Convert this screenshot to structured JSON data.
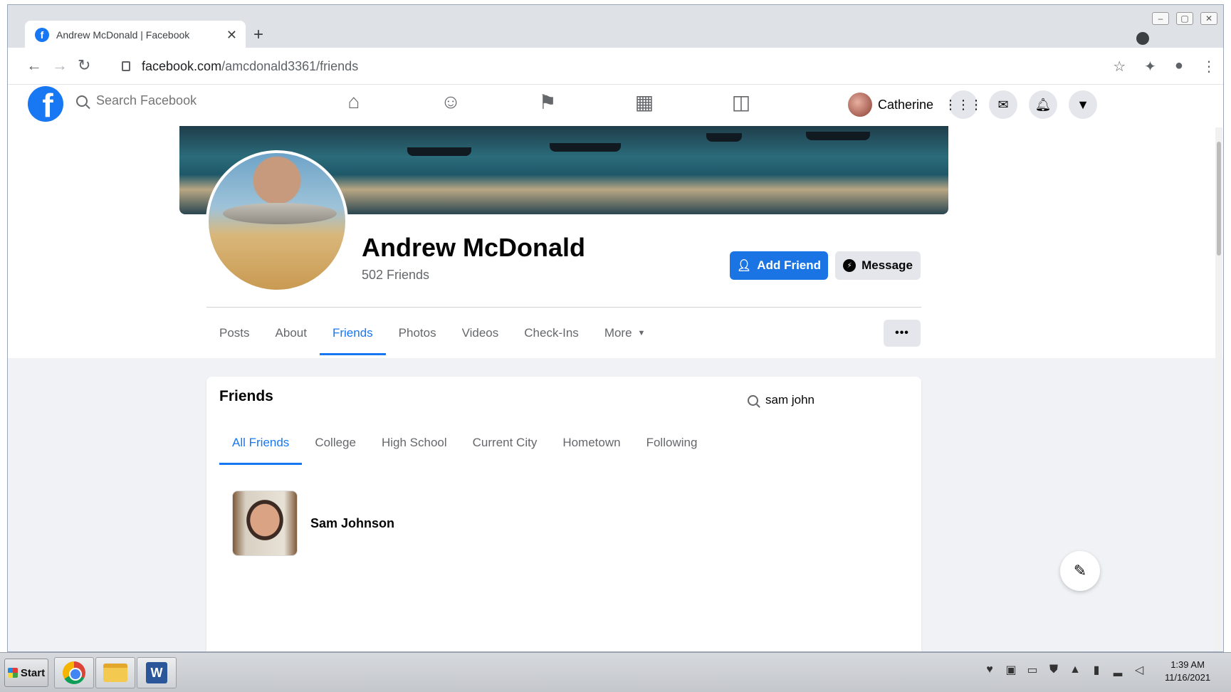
{
  "browser": {
    "tab_title": "Andrew McDonald | Facebook",
    "tab_close": "✕",
    "new_tab": "+",
    "url_host": "facebook.com",
    "url_path": "/amcdonald3361/friends",
    "icons": [
      "back-icon",
      "forward-icon",
      "reload-icon",
      "lock-icon",
      "star-icon",
      "extensions-icon",
      "profile-icon",
      "menu-icon"
    ]
  },
  "fb_header": {
    "logo": "f",
    "search_placeholder": "Search Facebook",
    "nav_icons": [
      "home-icon",
      "friends-icon",
      "pages-icon",
      "marketplace-icon",
      "gaming-icon"
    ],
    "user_name": "Catherine",
    "action_icons": [
      "menu-grid-icon",
      "messenger-icon",
      "notifications-icon",
      "account-dropdown-icon"
    ]
  },
  "profile": {
    "name": "Andrew McDonald",
    "friend_count": "502 Friends",
    "add_friend_label": "Add Friend",
    "message_label": "Message",
    "tabs": [
      {
        "label": "Posts",
        "active": false
      },
      {
        "label": "About",
        "active": false
      },
      {
        "label": "Friends",
        "active": true
      },
      {
        "label": "Photos",
        "active": false
      },
      {
        "label": "Videos",
        "active": false
      },
      {
        "label": "Check-Ins",
        "active": false
      },
      {
        "label": "More",
        "active": false
      }
    ],
    "more_options": "•••"
  },
  "friends_section": {
    "title": "Friends",
    "search_value": "sam john",
    "tabs": [
      {
        "label": "All Friends",
        "active": true
      },
      {
        "label": "College",
        "active": false
      },
      {
        "label": "High School",
        "active": false
      },
      {
        "label": "Current City",
        "active": false
      },
      {
        "label": "Hometown",
        "active": false
      },
      {
        "label": "Following",
        "active": false
      }
    ],
    "results": [
      {
        "name": "Sam Johnson"
      }
    ]
  },
  "taskbar": {
    "start_label": "Start",
    "word_letter": "W",
    "time": "1:39 AM",
    "date": "11/16/2021"
  },
  "colors": {
    "facebook_blue": "#1877f2",
    "button_blue": "#1b74e4",
    "secondary_text": "#65676b"
  }
}
